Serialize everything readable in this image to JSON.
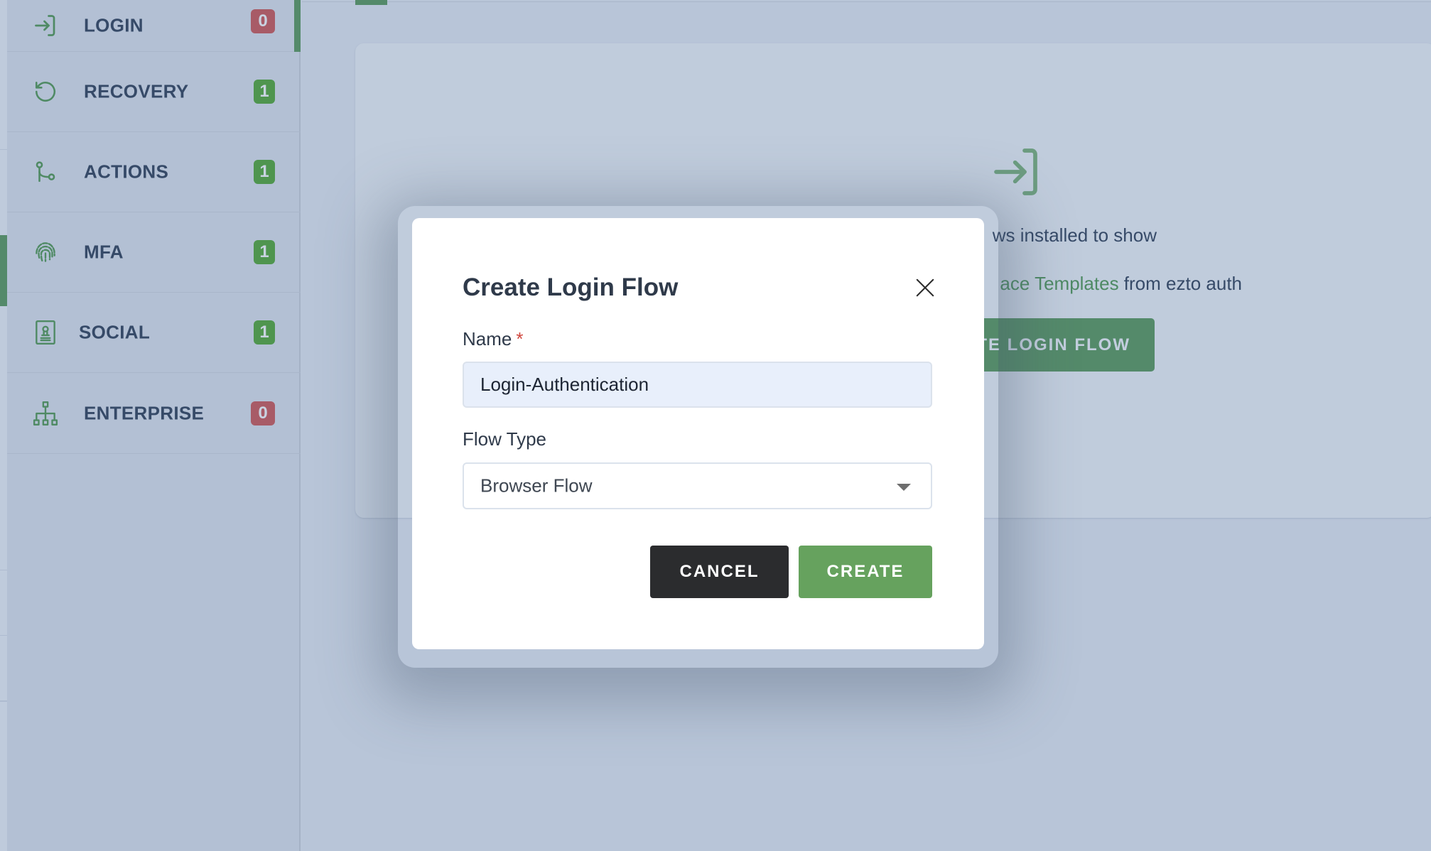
{
  "sidebar": {
    "items": [
      {
        "label": "LOGIN",
        "icon": "login-arrow-icon",
        "count": "0",
        "status": "zero",
        "active": true
      },
      {
        "label": "RECOVERY",
        "icon": "recovery-icon",
        "count": "1",
        "status": "nonzero"
      },
      {
        "label": "ACTIONS",
        "icon": "actions-branch-icon",
        "count": "1",
        "status": "nonzero"
      },
      {
        "label": "MFA",
        "icon": "fingerprint-icon",
        "count": "1",
        "status": "nonzero"
      },
      {
        "label": "SOCIAL",
        "icon": "id-badge-icon",
        "count": "1",
        "status": "nonzero"
      },
      {
        "label": "ENTERPRISE",
        "icon": "org-chart-icon",
        "count": "0",
        "status": "zero"
      }
    ]
  },
  "empty_state": {
    "icon": "login-arrow-icon",
    "line1": "ws installed to show",
    "line2_link": "ace Templates",
    "line2_rest": " from ezto auth",
    "button_label": "ATE LOGIN FLOW"
  },
  "modal": {
    "title": "Create Login Flow",
    "close_icon": "close-icon",
    "name_label": "Name",
    "name_required_mark": "*",
    "name_value": "Login-Authentication",
    "flow_type_label": "Flow Type",
    "flow_type_value": "Browser Flow",
    "cancel_label": "CANCEL",
    "create_label": "CREATE"
  },
  "colors": {
    "accent_green": "#548a6a",
    "badge_green": "#4f954f",
    "badge_red": "#a85b67",
    "create_button": "#66a25e",
    "cancel_button": "#2b2c2e",
    "required": "#d0473e"
  }
}
